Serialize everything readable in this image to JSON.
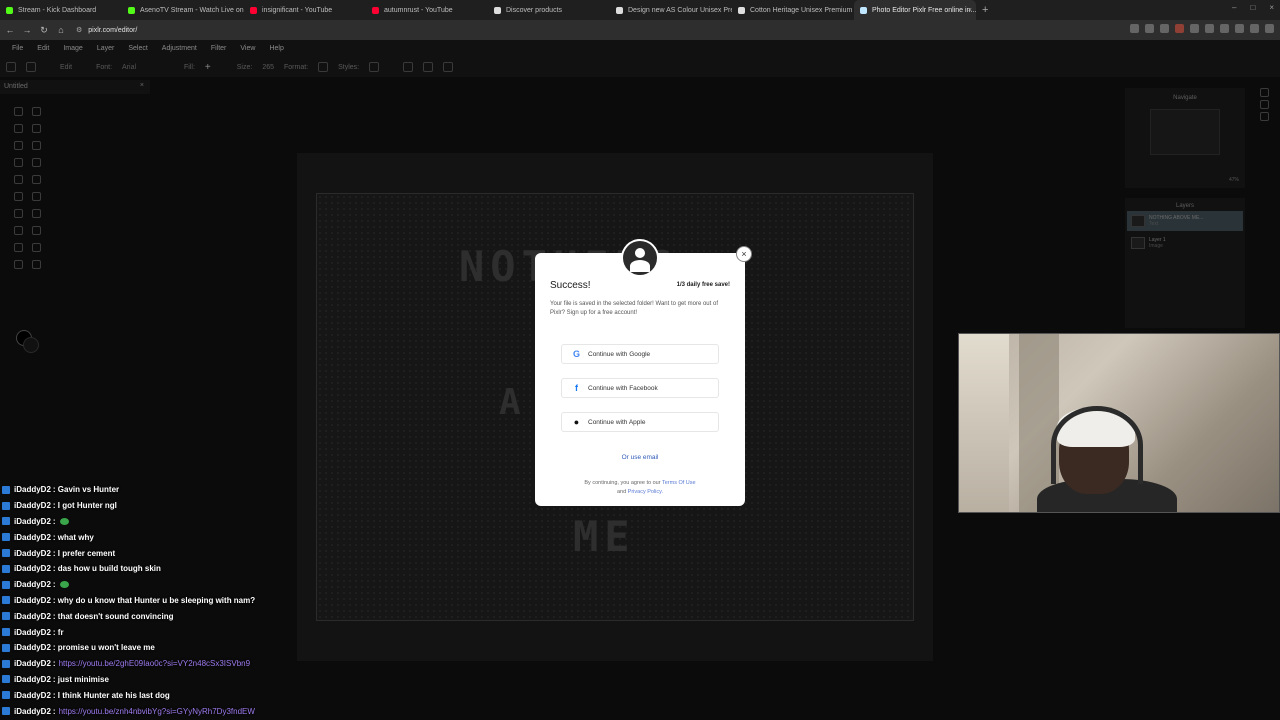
{
  "browser": {
    "tabs": [
      {
        "label": "Stream - Kick Dashboard",
        "favicon_color": "#53fc18"
      },
      {
        "label": "AsenoTV Stream - Watch Live on Kick",
        "favicon_color": "#53fc18"
      },
      {
        "label": "insignificant - YouTube",
        "favicon_color": "#ff0033"
      },
      {
        "label": "autumnrust - YouTube",
        "favicon_color": "#ff0033"
      },
      {
        "label": "Discover products",
        "favicon_color": "#dddddd"
      },
      {
        "label": "Design new AS Colour Unisex Premi...",
        "favicon_color": "#dddddd"
      },
      {
        "label": "Cotton Heritage Unisex Premium H...",
        "favicon_color": "#dddddd"
      },
      {
        "label": "Photo Editor Pixlr Free online in...",
        "favicon_color": "#bfe7ff",
        "active": true
      }
    ],
    "new_tab": "+",
    "url": "pixlr.com/editor/"
  },
  "app": {
    "menu": [
      "File",
      "Edit",
      "Image",
      "Layer",
      "Select",
      "Adjustment",
      "Filter",
      "View",
      "Help"
    ],
    "toolbar": {
      "edit": "Edit",
      "font_label": "Font:",
      "font_value": "Arial",
      "fill_label": "Fill:",
      "size_label": "Size:",
      "size_value": "265",
      "format_label": "Format:",
      "styles_label": "Styles:"
    },
    "doc_tab": "Untitled",
    "canvas_text": {
      "line1": "NOTHING",
      "line2": "A",
      "line3": "ME"
    },
    "navigate_title": "Navigate",
    "zoom_value": "47%",
    "layers_title": "Layers",
    "layers": [
      {
        "name": "NOTHING ABOVE ME...",
        "sub": "Text",
        "active": true
      },
      {
        "name": "Layer 1",
        "sub": "Image",
        "active": false
      }
    ]
  },
  "modal": {
    "title": "Success!",
    "quota": "1/3 daily free save!",
    "message": "Your file is saved in the selected folder! Want to get more out of Pixlr? Sign up for a free account!",
    "google_label": "Continue with Google",
    "facebook_label": "Continue with Facebook",
    "apple_label": "Continue with Apple",
    "email_label": "Or use email",
    "terms_prefix": "By continuing, you agree to our",
    "terms_link": "Terms Of Use",
    "terms_and": "and",
    "privacy_link": "Privacy Policy.",
    "close": "×"
  },
  "chat": [
    {
      "user": "iDaddyD2",
      "text": ": Gavin vs Hunter"
    },
    {
      "user": "iDaddyD2",
      "text": ": I got Hunter ngl"
    },
    {
      "user": "iDaddyD2",
      "text": ":",
      "emote": true
    },
    {
      "user": "iDaddyD2",
      "text": ": what why"
    },
    {
      "user": "iDaddyD2",
      "text": ": I prefer cement"
    },
    {
      "user": "iDaddyD2",
      "text": ": das how u build tough skin"
    },
    {
      "user": "iDaddyD2",
      "text": ":",
      "emote": true
    },
    {
      "user": "iDaddyD2",
      "text": ": why do u know that Hunter u be sleeping with nam?"
    },
    {
      "user": "iDaddyD2",
      "text": ": that doesn't sound convincing"
    },
    {
      "user": "iDaddyD2",
      "text": ": fr"
    },
    {
      "user": "iDaddyD2",
      "text": ": promise u won't leave me"
    },
    {
      "user": "iDaddyD2",
      "text": ":",
      "link": "https://youtu.be/2ghE09Iao0c?si=VY2n48cSx3ISVbn9"
    },
    {
      "user": "iDaddyD2",
      "text": ": just minimise"
    },
    {
      "user": "iDaddyD2",
      "text": ": I think Hunter ate his last dog"
    },
    {
      "user": "iDaddyD2",
      "text": ":",
      "link": "https://youtu.be/znh4nbvibYg?si=GYyNyRh7Dy3fndEW"
    }
  ]
}
